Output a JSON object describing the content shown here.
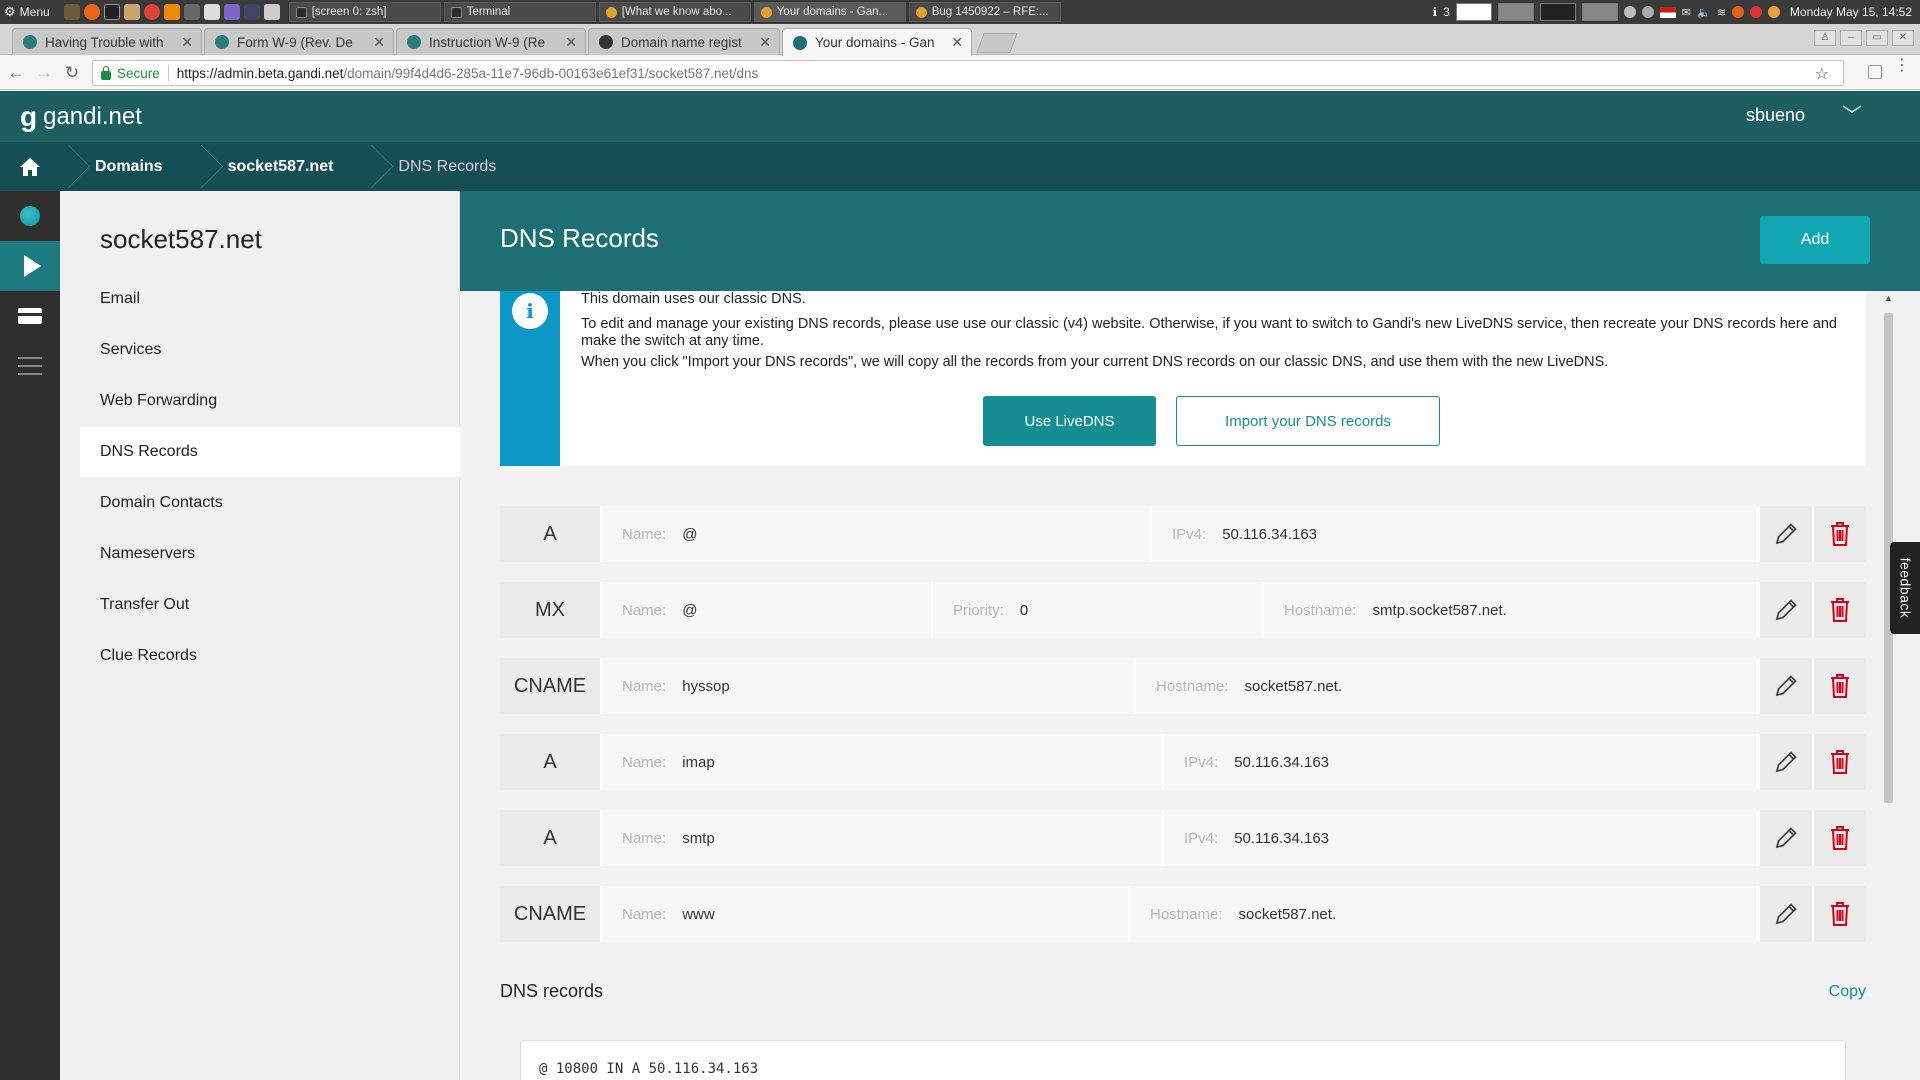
{
  "os": {
    "menu_label": "Menu",
    "windows": [
      {
        "label": "[screen 0: zsh]",
        "color": "#2c2c2c"
      },
      {
        "label": "Terminal",
        "color": "#2c2c2c"
      },
      {
        "label": "[What we know abo...",
        "color": "#e0a030"
      },
      {
        "label": "Your domains - Gan...",
        "color": "#e0a030"
      },
      {
        "label": "Bug 1450922 – RFE:...",
        "color": "#e0a030"
      }
    ],
    "tray_count": "3",
    "clock": "Monday May 15, 14:52"
  },
  "browser": {
    "tabs": [
      {
        "label": "Having Trouble with",
        "icon_color": "#2e7d7d",
        "active": false
      },
      {
        "label": "Form W-9 (Rev. De",
        "icon_color": "#2e7d7d",
        "active": false
      },
      {
        "label": "Instruction W-9 (Re",
        "icon_color": "#2e7d7d",
        "active": false
      },
      {
        "label": "Domain name regist",
        "icon_color": "#333333",
        "active": false
      },
      {
        "label": "Your domains - Gan",
        "icon_color": "#1e6f73",
        "active": true
      }
    ],
    "secure_label": "Secure",
    "url_host": "https://admin.beta.gandi.net",
    "url_path": "/domain/99f4d4d6-285a-11e7-96db-00163e61ef31/socket587.net/dns"
  },
  "header": {
    "logo_mark": "g",
    "logo_text": "gandi.net",
    "username": "sbueno"
  },
  "breadcrumb": {
    "items": [
      "Domains",
      "socket587.net"
    ],
    "current": "DNS Records"
  },
  "sidebar": {
    "domain": "socket587.net",
    "items": [
      {
        "label": "Email"
      },
      {
        "label": "Services"
      },
      {
        "label": "Web Forwarding"
      },
      {
        "label": "DNS Records",
        "active": true
      },
      {
        "label": "Domain Contacts"
      },
      {
        "label": "Nameservers"
      },
      {
        "label": "Transfer Out"
      },
      {
        "label": "Clue Records"
      }
    ]
  },
  "main": {
    "title": "DNS Records",
    "add_label": "Add",
    "notice": {
      "line1": "This domain uses our classic DNS.",
      "line2": "To edit and manage your existing DNS records, please use use our classic (v4) website. Otherwise, if you want to switch to Gandi's new LiveDNS service, then recreate your DNS records here and make the switch at any time.",
      "line3": "When you click \"Import your DNS records\", we will copy all the records from your current DNS records on our classic DNS, and use them with the new LiveDNS.",
      "use_live_label": "Use LiveDNS",
      "import_label": "Import your DNS records"
    },
    "records": [
      {
        "type": "A",
        "fields": [
          {
            "label": "Name:",
            "value": "@"
          },
          {
            "label": "IPv4:",
            "value": "50.116.34.163"
          }
        ]
      },
      {
        "type": "MX",
        "fields": [
          {
            "label": "Name:",
            "value": "@"
          },
          {
            "label": "Priority:",
            "value": "0"
          },
          {
            "label": "Hostname:",
            "value": "smtp.socket587.net."
          }
        ]
      },
      {
        "type": "CNAME",
        "fields": [
          {
            "label": "Name:",
            "value": "hyssop"
          },
          {
            "label": "Hostname:",
            "value": "socket587.net."
          }
        ]
      },
      {
        "type": "A",
        "fields": [
          {
            "label": "Name:",
            "value": "imap"
          },
          {
            "label": "IPv4:",
            "value": "50.116.34.163"
          }
        ]
      },
      {
        "type": "A",
        "fields": [
          {
            "label": "Name:",
            "value": "smtp"
          },
          {
            "label": "IPv4:",
            "value": "50.116.34.163"
          }
        ]
      },
      {
        "type": "CNAME",
        "fields": [
          {
            "label": "Name:",
            "value": "www"
          },
          {
            "label": "Hostname:",
            "value": "socket587.net."
          }
        ]
      }
    ],
    "dns_section_title": "DNS records",
    "copy_label": "Copy",
    "zone_line": "@ 10800 IN A 50.116.34.163",
    "feedback_label": "feedback"
  },
  "colors": {
    "brand_dark": "#1e5d60",
    "brand_accent": "#168d93",
    "info_blue": "#0d97c7",
    "delete_red": "#d0021b"
  }
}
